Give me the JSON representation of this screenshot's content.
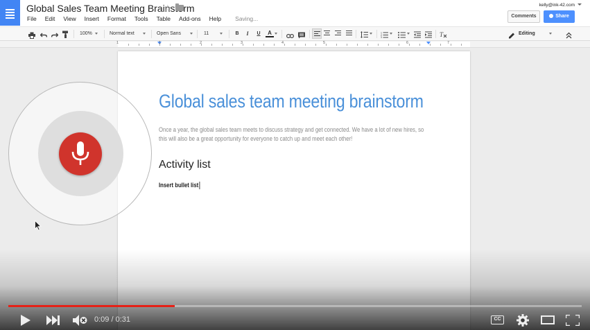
{
  "header": {
    "doc_title": "Global Sales Team Meeting Brainstorm",
    "account": "kelly@ink-42.com",
    "comments_label": "Comments",
    "share_label": "Share",
    "menu": [
      "File",
      "Edit",
      "View",
      "Insert",
      "Format",
      "Tools",
      "Table",
      "Add-ons",
      "Help"
    ],
    "status": "Saving..."
  },
  "toolbar": {
    "zoom": "100%",
    "style": "Normal text",
    "font": "Open Sans",
    "size": "11",
    "bold": "B",
    "italic": "I",
    "underline": "U",
    "text_color": "A",
    "mode": "Editing"
  },
  "ruler": {
    "numbers": [
      "1",
      "1",
      "2",
      "3",
      "4",
      "5",
      "6",
      "7"
    ]
  },
  "document": {
    "title": "Global sales team meeting brainstorm",
    "paragraph": "Once a year, the global sales team meets to discuss strategy and get connected.  We have a lot of new hires, so this will also be a great opportunity for everyone to catch up and meet each other!",
    "heading2": "Activity list",
    "line": "Insert bullet list"
  },
  "player": {
    "time": "0:09 / 0:31",
    "progress": 0.29,
    "cc": "CC"
  },
  "colors": {
    "docs_blue": "#4285f4",
    "heading_blue": "#4a90d9",
    "mic_red": "#d0342c",
    "progress_red": "#e62117"
  },
  "icons": [
    "docs-logo-icon",
    "star-icon",
    "folder-icon",
    "print-icon",
    "undo-icon",
    "redo-icon",
    "paint-format-icon",
    "link-icon",
    "comment-icon",
    "align-left-icon",
    "align-center-icon",
    "align-right-icon",
    "justify-icon",
    "line-spacing-icon",
    "numbered-list-icon",
    "bulleted-list-icon",
    "decrease-indent-icon",
    "increase-indent-icon",
    "clear-formatting-icon",
    "pencil-icon",
    "collapse-icon",
    "microphone-icon",
    "play-icon",
    "next-icon",
    "volume-muted-icon",
    "settings-icon",
    "theater-mode-icon",
    "fullscreen-icon"
  ]
}
